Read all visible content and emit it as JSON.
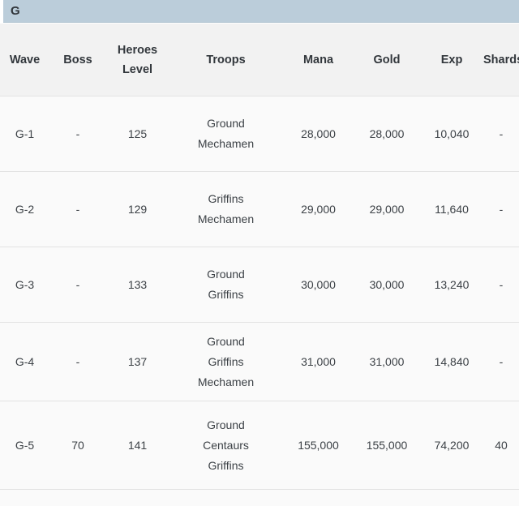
{
  "section": {
    "label": "G"
  },
  "table": {
    "columns": [
      {
        "key": "wave",
        "lines": [
          "Wave"
        ]
      },
      {
        "key": "boss",
        "lines": [
          "Boss"
        ]
      },
      {
        "key": "level",
        "lines": [
          "Heroes",
          "Level"
        ]
      },
      {
        "key": "troops",
        "lines": [
          "Troops"
        ]
      },
      {
        "key": "mana",
        "lines": [
          "Mana"
        ]
      },
      {
        "key": "gold",
        "lines": [
          "Gold"
        ]
      },
      {
        "key": "exp",
        "lines": [
          "Exp"
        ]
      },
      {
        "key": "shards",
        "lines": [
          "Shards"
        ]
      }
    ],
    "rows": [
      {
        "wave": "G-1",
        "boss": "-",
        "level": "125",
        "troops": [
          "Ground",
          "Mechamen"
        ],
        "mana": "28,000",
        "gold": "28,000",
        "exp": "10,040",
        "shards": "-"
      },
      {
        "wave": "G-2",
        "boss": "-",
        "level": "129",
        "troops": [
          "Griffins",
          "Mechamen"
        ],
        "mana": "29,000",
        "gold": "29,000",
        "exp": "11,640",
        "shards": "-"
      },
      {
        "wave": "G-3",
        "boss": "-",
        "level": "133",
        "troops": [
          "Ground",
          "Griffins"
        ],
        "mana": "30,000",
        "gold": "30,000",
        "exp": "13,240",
        "shards": "-"
      },
      {
        "wave": "G-4",
        "boss": "-",
        "level": "137",
        "troops": [
          "Ground",
          "Griffins",
          "Mechamen"
        ],
        "mana": "31,000",
        "gold": "31,000",
        "exp": "14,840",
        "shards": "-"
      },
      {
        "wave": "G-5",
        "boss": "70",
        "level": "141",
        "troops": [
          "Ground",
          "Centaurs",
          "Griffins"
        ],
        "mana": "155,000",
        "gold": "155,000",
        "exp": "74,200",
        "shards": "40"
      }
    ]
  },
  "colors": {
    "section_bar": "#bbcdda",
    "header_row": "#f2f2f2",
    "row_background": "#fafafa",
    "divider": "#e3e3e3",
    "text": "#3c4146"
  }
}
